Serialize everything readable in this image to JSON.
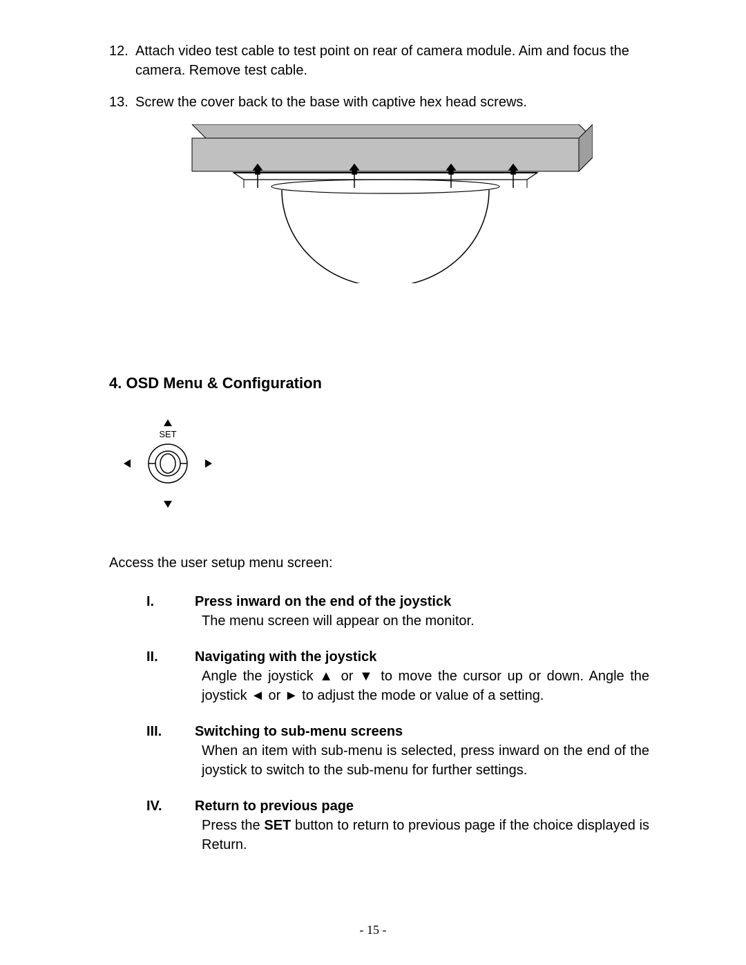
{
  "steps": {
    "s12_num": "12.",
    "s12": "Attach video test cable to test point on rear of camera module. Aim and focus the camera. Remove test cable.",
    "s13_num": "13.",
    "s13": "Screw the cover back to the base with captive hex head screws."
  },
  "heading": "4. OSD Menu & Configuration",
  "joystick_label": "SET",
  "access": "Access the user setup menu screen:",
  "roman": {
    "i_num": "I.",
    "i_title": "Press inward on the end of the joystick",
    "i_text": "The menu screen will appear on the monitor.",
    "ii_num": "II.",
    "ii_title": "Navigating with the joystick",
    "ii_text_a": "Angle the joystick ",
    "ii_up": "▲",
    "ii_text_b": " or ",
    "ii_down": "▼",
    "ii_text_c": " to move the cursor up or down. Angle the joystick ",
    "ii_left": "◄",
    "ii_text_d": " or ",
    "ii_right": "►",
    "ii_text_e": " to adjust the mode or value of a setting.",
    "iii_num": "III.",
    "iii_title": "Switching to sub-menu screens",
    "iii_text": "When an item with sub-menu is selected, press inward on the end of the joystick to switch to the sub-menu for further settings.",
    "iv_num": "IV.",
    "iv_title": "Return to previous page",
    "iv_text_a": "Press the ",
    "iv_set": "SET",
    "iv_text_b": " button to return to previous page if the choice displayed is Return."
  },
  "page_number": "- 15 -"
}
